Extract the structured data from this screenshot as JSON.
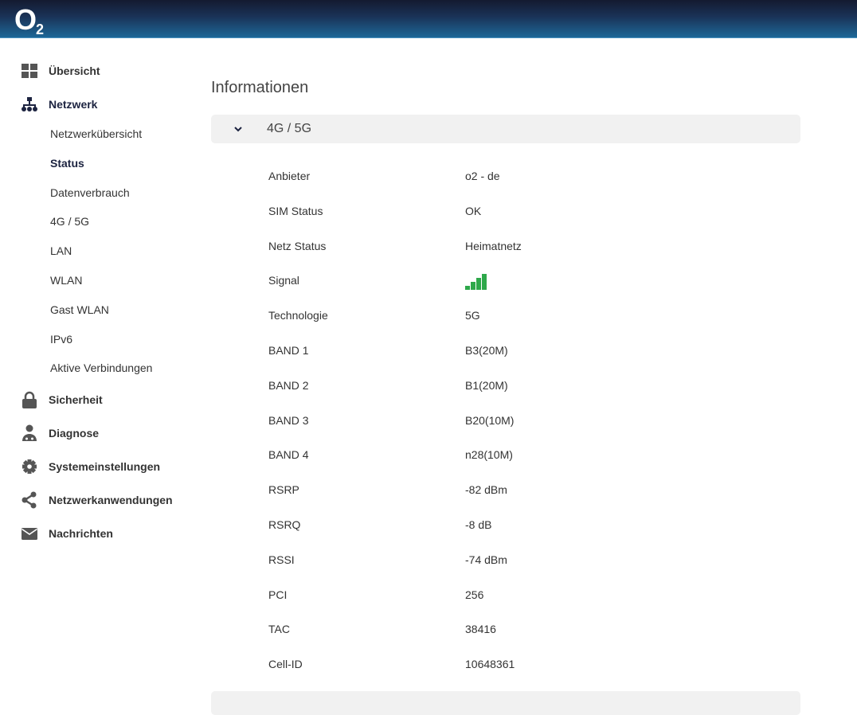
{
  "header": {
    "logo": "O2"
  },
  "sidebar": {
    "items": [
      {
        "label": "Übersicht",
        "icon": "dashboard-icon"
      },
      {
        "label": "Netzwerk",
        "icon": "network-icon"
      },
      {
        "label": "Sicherheit",
        "icon": "lock-icon"
      },
      {
        "label": "Diagnose",
        "icon": "doctor-icon"
      },
      {
        "label": "Systemeinstellungen",
        "icon": "gear-icon"
      },
      {
        "label": "Netzwerkanwendungen",
        "icon": "share-icon"
      },
      {
        "label": "Nachrichten",
        "icon": "envelope-icon"
      }
    ],
    "subitems": [
      "Netzwerkübersicht",
      "Status",
      "Datenverbrauch",
      "4G / 5G",
      "LAN",
      "WLAN",
      "Gast WLAN",
      "IPv6",
      "Aktive Verbindungen"
    ]
  },
  "main": {
    "title": "Informationen",
    "section": "4G / 5G",
    "signal_bars": 4,
    "signal_color": "#2ea84a",
    "rows": [
      {
        "k": "Anbieter",
        "v": "o2 - de"
      },
      {
        "k": "SIM Status",
        "v": "OK"
      },
      {
        "k": "Netz Status",
        "v": "Heimatnetz"
      },
      {
        "k": "Signal",
        "v": null
      },
      {
        "k": "Technologie",
        "v": "5G"
      },
      {
        "k": "BAND 1",
        "v": "B3(20M)"
      },
      {
        "k": "BAND 2",
        "v": "B1(20M)"
      },
      {
        "k": "BAND 3",
        "v": "B20(10M)"
      },
      {
        "k": "BAND 4",
        "v": "n28(10M)"
      },
      {
        "k": "RSRP",
        "v": "-82 dBm"
      },
      {
        "k": "RSRQ",
        "v": "-8 dB"
      },
      {
        "k": "RSSI",
        "v": "-74 dBm"
      },
      {
        "k": "PCI",
        "v": "256"
      },
      {
        "k": "TAC",
        "v": "38416"
      },
      {
        "k": "Cell-ID",
        "v": "10648361"
      }
    ]
  }
}
